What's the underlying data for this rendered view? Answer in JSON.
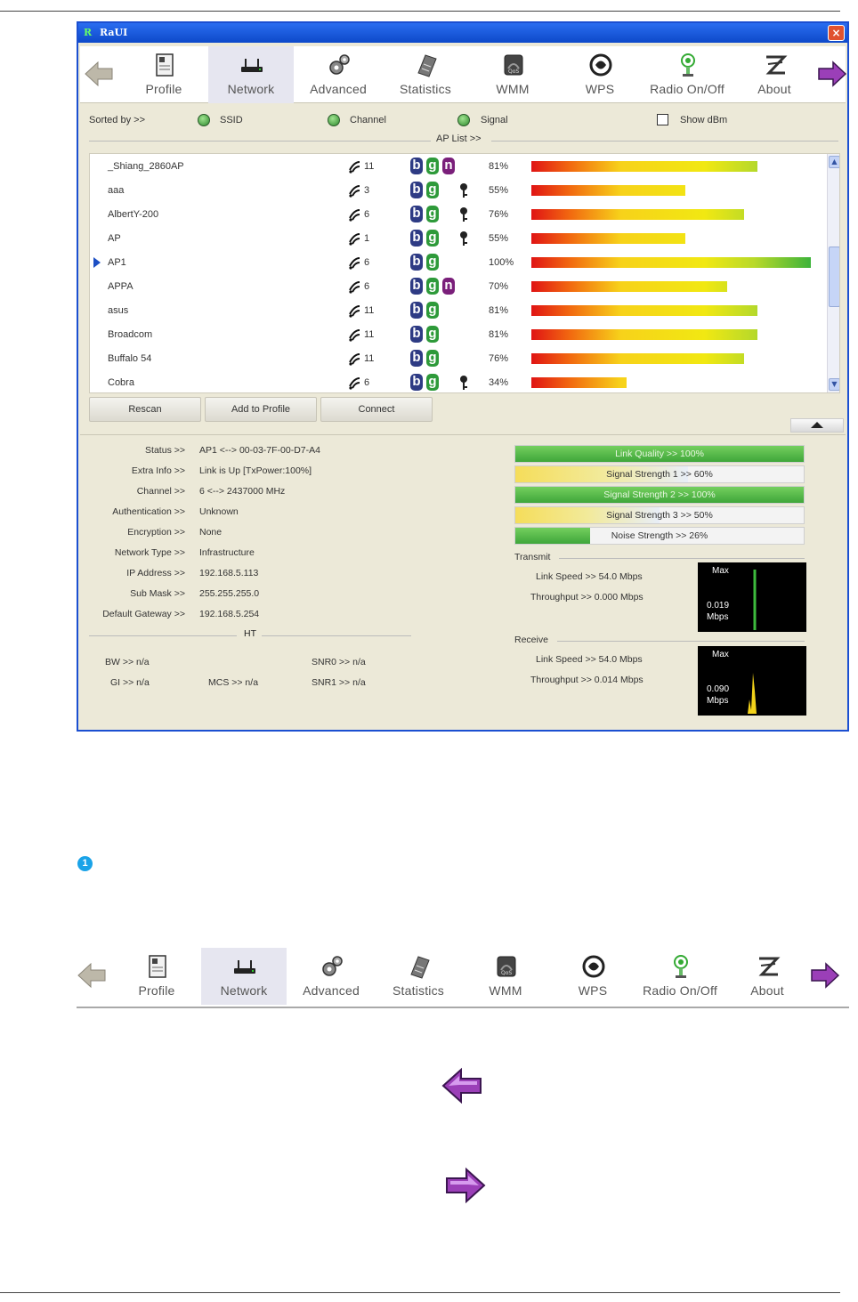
{
  "window": {
    "title": "RaUI",
    "close_glyph": "×"
  },
  "toolbar": {
    "buttons": [
      {
        "label": "Profile",
        "icon": "profile-icon"
      },
      {
        "label": "Network",
        "icon": "network-icon",
        "selected": true
      },
      {
        "label": "Advanced",
        "icon": "gears-icon"
      },
      {
        "label": "Statistics",
        "icon": "statistics-icon"
      },
      {
        "label": "WMM",
        "icon": "wmm-icon"
      },
      {
        "label": "WPS",
        "icon": "wps-icon"
      },
      {
        "label": "Radio On/Off",
        "icon": "radio-icon"
      },
      {
        "label": "About",
        "icon": "about-icon"
      }
    ]
  },
  "sortbar": {
    "sorted_by": "Sorted by >>",
    "ssid": "SSID",
    "channel": "Channel",
    "signal": "Signal",
    "show_dbm": "Show dBm",
    "ap_list": "AP List >>"
  },
  "ap_list": [
    {
      "ssid": "_Shiang_2860AP",
      "channel": "11",
      "modes": [
        "b",
        "g",
        "n"
      ],
      "secure": false,
      "signal": "81%",
      "signal_value": 81
    },
    {
      "ssid": "aaa",
      "channel": "3",
      "modes": [
        "b",
        "g"
      ],
      "secure": true,
      "signal": "55%",
      "signal_value": 55
    },
    {
      "ssid": "AlbertY-200",
      "channel": "6",
      "modes": [
        "b",
        "g"
      ],
      "secure": true,
      "signal": "76%",
      "signal_value": 76
    },
    {
      "ssid": "AP",
      "channel": "1",
      "modes": [
        "b",
        "g"
      ],
      "secure": true,
      "signal": "55%",
      "signal_value": 55
    },
    {
      "ssid": "AP1",
      "channel": "6",
      "modes": [
        "b",
        "g"
      ],
      "secure": false,
      "signal": "100%",
      "signal_value": 100,
      "selected": true
    },
    {
      "ssid": "APPA",
      "channel": "6",
      "modes": [
        "b",
        "g",
        "n"
      ],
      "secure": false,
      "signal": "70%",
      "signal_value": 70
    },
    {
      "ssid": "asus",
      "channel": "11",
      "modes": [
        "b",
        "g"
      ],
      "secure": false,
      "signal": "81%",
      "signal_value": 81
    },
    {
      "ssid": "Broadcom",
      "channel": "11",
      "modes": [
        "b",
        "g"
      ],
      "secure": false,
      "signal": "81%",
      "signal_value": 81
    },
    {
      "ssid": "Buffalo 54",
      "channel": "11",
      "modes": [
        "b",
        "g"
      ],
      "secure": false,
      "signal": "76%",
      "signal_value": 76
    },
    {
      "ssid": "Cobra",
      "channel": "6",
      "modes": [
        "b",
        "g"
      ],
      "secure": true,
      "signal": "34%",
      "signal_value": 34
    }
  ],
  "buttons": {
    "rescan": "Rescan",
    "add_to_profile": "Add to Profile",
    "connect": "Connect"
  },
  "status": {
    "status_label": "Status >>",
    "status_value": "AP1 <--> 00-03-7F-00-D7-A4",
    "extra_label": "Extra Info >>",
    "extra_value": "Link is Up [TxPower:100%]",
    "channel_label": "Channel >>",
    "channel_value": "6 <--> 2437000 MHz",
    "auth_label": "Authentication >>",
    "auth_value": "Unknown",
    "enc_label": "Encryption >>",
    "enc_value": "None",
    "nettype_label": "Network Type >>",
    "nettype_value": "Infrastructure",
    "ip_label": "IP Address >>",
    "ip_value": "192.168.5.113",
    "mask_label": "Sub Mask >>",
    "mask_value": "255.255.255.0",
    "gw_label": "Default Gateway >>",
    "gw_value": "192.168.5.254"
  },
  "ht": {
    "title": "HT",
    "bw": "BW >> n/a",
    "gi": "GI >> n/a",
    "mcs": "MCS >> n/a",
    "snr0": "SNR0 >> n/a",
    "snr1": "SNR1 >> n/a"
  },
  "quality": [
    {
      "label": "Link Quality >> 100%",
      "value": 100,
      "color": "green"
    },
    {
      "label": "Signal Strength 1 >> 60%",
      "value": 60,
      "color": "yellow"
    },
    {
      "label": "Signal Strength 2 >> 100%",
      "value": 100,
      "color": "green"
    },
    {
      "label": "Signal Strength 3 >> 50%",
      "value": 50,
      "color": "yellow"
    },
    {
      "label": "Noise Strength >> 26%",
      "value": 26,
      "color": "green"
    }
  ],
  "transmit": {
    "title": "Transmit",
    "link_speed": "Link Speed >> 54.0 Mbps",
    "throughput": "Throughput >> 0.000 Mbps",
    "graph_max": "Max",
    "graph_value": "0.019",
    "graph_unit": "Mbps",
    "graph_color": "#3dbb3d"
  },
  "receive": {
    "title": "Receive",
    "link_speed": "Link Speed >> 54.0 Mbps",
    "throughput": "Throughput >> 0.014 Mbps",
    "graph_max": "Max",
    "graph_value": "0.090",
    "graph_unit": "Mbps",
    "graph_color": "#f2d21a"
  },
  "doc": {
    "note_number": "1"
  },
  "colors": {
    "title_bar": "#0d49c9",
    "nav_arrow": "#9b3fb8",
    "mode_b": "#2e3b84",
    "mode_g": "#2e9a3a",
    "mode_n": "#7a1f7a"
  }
}
